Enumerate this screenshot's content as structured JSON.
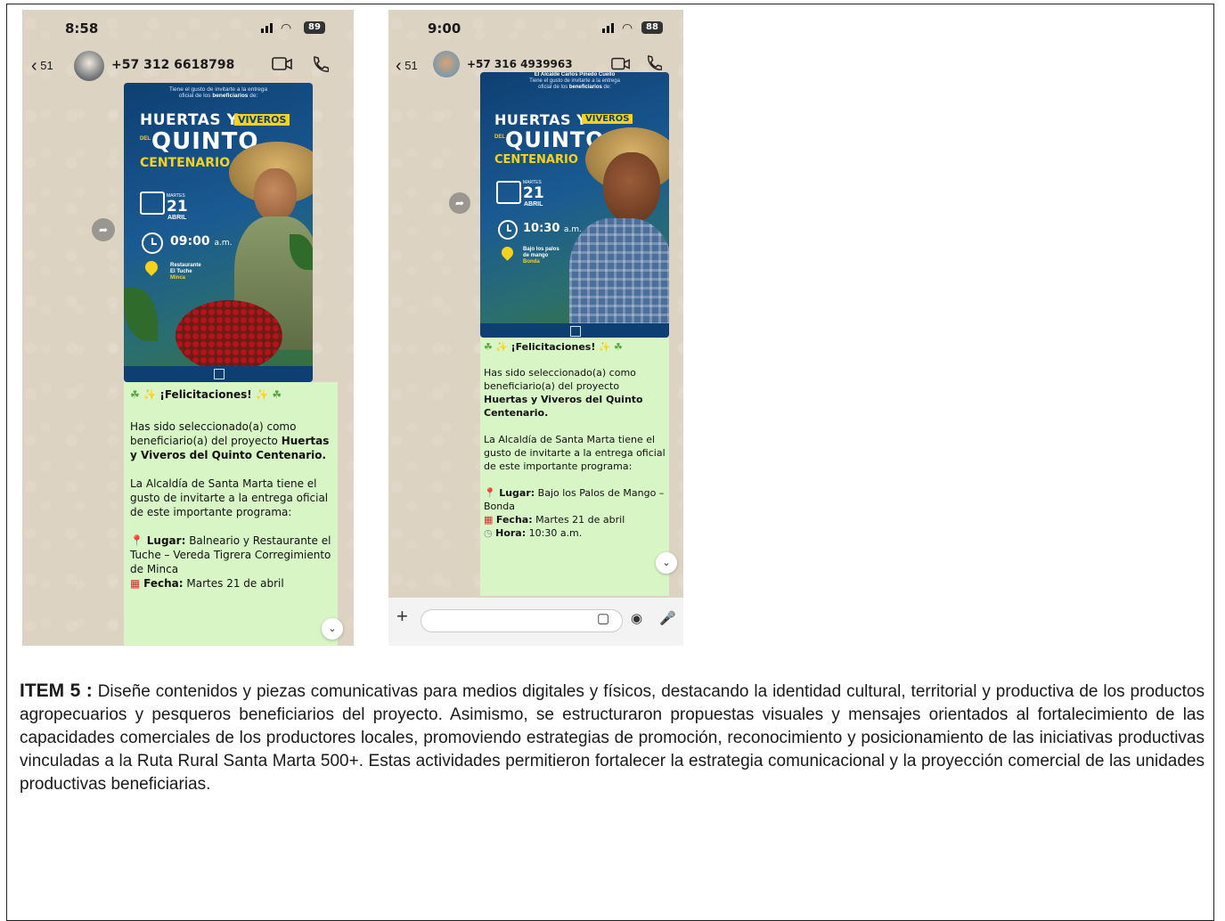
{
  "phone1": {
    "status": {
      "time": "8:58",
      "battery": "89"
    },
    "header": {
      "back_count": "51",
      "contact": "+57 312 6618798"
    },
    "poster": {
      "invite_line1": "Tiene el gusto de invitarte a la entrega",
      "invite_line2": "oficial de los",
      "invite_bold": "beneficiarios",
      "invite_end": "de:",
      "title_part1": "HUERTAS Y",
      "title_part2": "VIVEROS",
      "title_del": "DEL",
      "title_quinto": "QUINTO",
      "title_centenario": "CENTENARIO",
      "weekday": "MARTES",
      "day": "21",
      "month": "ABRIL",
      "time": "09:00",
      "time_suffix": "a.m.",
      "place_line1": "Restaurante",
      "place_line2": "El Tuche",
      "place_line3": "Minca"
    },
    "message": {
      "congrats": "¡Felicitaciones!",
      "p1_start": "Has sido seleccionado(a) como beneficiario(a) del proyecto",
      "p1_bold": "Huertas y Viveros del Quinto Centenario.",
      "p2": "La Alcaldía de Santa Marta tiene el gusto de invitarte a la entrega oficial de este importante programa:",
      "lugar_label": "Lugar:",
      "lugar_value": "Balneario y Restaurante el Tuche  – Vereda Tigrera Corregimiento de Minca",
      "fecha_label": "Fecha:",
      "fecha_value": "Martes 21 de abril"
    }
  },
  "phone2": {
    "status": {
      "time": "9:00",
      "battery": "88"
    },
    "header": {
      "back_count": "51",
      "contact": "+57 316 4939963"
    },
    "poster": {
      "top_line": "El Alcalde Carlos Pinedo Cuello",
      "invite_line1": "Tiene el gusto de invitarte a la entrega",
      "invite_line2": "oficial de los",
      "invite_bold": "beneficiarios",
      "invite_end": "de:",
      "title_part1": "HUERTAS Y",
      "title_part2": "VIVEROS",
      "title_del": "DEL",
      "title_quinto": "QUINTO",
      "title_centenario": "CENTENARIO",
      "weekday": "MARTES",
      "day": "21",
      "month": "ABRIL",
      "time": "10:30",
      "time_suffix": "a.m.",
      "place_line1": "Bajo los palos",
      "place_line2": "de mango",
      "place_line3": "Bonda"
    },
    "message": {
      "congrats": "¡Felicitaciones!",
      "p1_start": "Has sido seleccionado(a) como beneficiario(a) del proyecto",
      "p1_bold": "Huertas y Viveros del Quinto Centenario.",
      "p2": "La Alcaldía de Santa Marta tiene el gusto de invitarte a la entrega oficial de este importante programa:",
      "lugar_label": "Lugar:",
      "lugar_value": "Bajo los Palos de Mango – Bonda",
      "fecha_label": "Fecha:",
      "fecha_value": "Martes 21 de abril",
      "hora_label": "Hora:",
      "hora_value": "10:30 a.m."
    }
  },
  "report": {
    "item_label": "ITEM 5 :",
    "item_text": "Diseñe contenidos y piezas comunicativas para medios digitales y físicos, destacando la identidad cultural, territorial y productiva de los productos agropecuarios y pesqueros beneficiarios del proyecto. Asimismo, se estructuraron propuestas visuales y mensajes orientados al fortalecimiento de las capacidades comerciales de los productores locales, promoviendo estrategias de promoción, reconocimiento y posicionamiento de las iniciativas productivas vinculadas a la Ruta Rural Santa Marta 500+. Estas actividades permitieron fortalecer la estrategia comunicacional y la proyección comercial de las unidades productivas beneficiarias."
  },
  "colors": {
    "chat_bubble": "#d8f5c6",
    "poster_blue": "#0e3f72",
    "poster_yellow": "#f7d21d",
    "chat_wallpaper": "#ddd3c3"
  }
}
